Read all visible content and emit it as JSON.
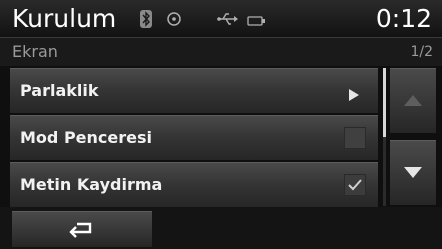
{
  "header": {
    "title": "Kurulum",
    "clock": "0:12"
  },
  "status_icons": [
    "bluetooth-icon",
    "disc-icon",
    "usb-icon",
    "plug-icon"
  ],
  "subheader": {
    "section": "Ekran",
    "page": "1/2"
  },
  "menu": {
    "items": [
      {
        "label": "Parlaklik",
        "control": "submenu-arrow"
      },
      {
        "label": "Mod Penceresi",
        "control": "checkbox",
        "checked": false
      },
      {
        "label": "Metin Kaydirma",
        "control": "checkbox",
        "checked": true
      }
    ]
  },
  "scroll": {
    "position": "top",
    "visible_fraction": 0.5
  },
  "nav": {
    "up": "scroll-up-icon",
    "down": "scroll-down-icon"
  },
  "footer": {
    "back": "back-icon"
  },
  "colors": {
    "background": "#0f0f0f",
    "row": "#3a3a3a",
    "text": "#f2f2f2",
    "muted": "#9a9a9a"
  }
}
